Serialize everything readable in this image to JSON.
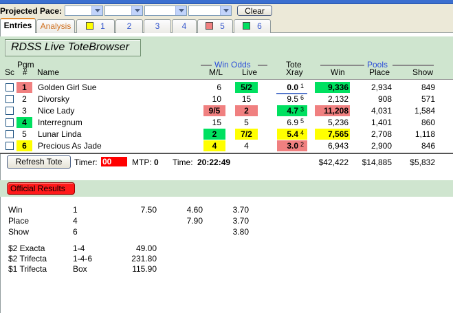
{
  "pace": {
    "label": "Projected Pace:",
    "clear_label": "Clear"
  },
  "tabs": {
    "entries": "Entries",
    "analysis": "Analysis",
    "t1": "1",
    "t2": "2",
    "t3": "3",
    "t4": "4",
    "t5": "5",
    "t6": "6",
    "colors": {
      "t1": "#ffff00",
      "t5": "#f08080",
      "t6": "#00e060"
    }
  },
  "title": "RDSS Live ToteBrowser",
  "headers": {
    "pgm": "Pgm",
    "sc": "Sc",
    "num": "#",
    "name": "Name",
    "win_odds": "Win Odds",
    "ml": "M/L",
    "live": "Live",
    "tote": "Tote",
    "xray": "Xray",
    "pools": "Pools",
    "win": "Win",
    "place": "Place",
    "show": "Show"
  },
  "colors": {
    "red": "#f08080",
    "green": "#00e060",
    "yellow": "#ffff00"
  },
  "entries": [
    {
      "pgm": "1",
      "name": "Golden Girl Sue",
      "ml": "6",
      "live": "5/2",
      "xray": "0.0",
      "xr": "1",
      "win": "9,336",
      "place": "2,934",
      "show": "849"
    },
    {
      "pgm": "2",
      "name": "Divorsky",
      "ml": "10",
      "live": "15",
      "xray": "9.5",
      "xr": "6",
      "win": "2,132",
      "place": "908",
      "show": "571"
    },
    {
      "pgm": "3",
      "name": "Nice Lady",
      "ml": "9/5",
      "live": "2",
      "xray": "4.7",
      "xr": "3",
      "win": "11,208",
      "place": "4,031",
      "show": "1,584"
    },
    {
      "pgm": "4",
      "name": "Interregnum",
      "ml": "15",
      "live": "5",
      "xray": "6.9",
      "xr": "5",
      "win": "5,236",
      "place": "1,401",
      "show": "860"
    },
    {
      "pgm": "5",
      "name": "Lunar Linda",
      "ml": "2",
      "live": "7/2",
      "xray": "5.4",
      "xr": "4",
      "win": "7,565",
      "place": "2,708",
      "show": "1,118"
    },
    {
      "pgm": "6",
      "name": "Precious As Jade",
      "ml": "4",
      "live": "4",
      "xray": "3.0",
      "xr": "2",
      "win": "6,943",
      "place": "2,900",
      "show": "846"
    }
  ],
  "footer": {
    "refresh_label": "Refresh Tote",
    "timer_label": "Timer:",
    "timer_value": "00",
    "mtp_label": "MTP:",
    "mtp_value": "0",
    "time_label": "Time:",
    "time_value": "20:22:49",
    "win_total": "$42,422",
    "place_total": "$14,885",
    "show_total": "$5,832"
  },
  "results": {
    "label": "Official Results",
    "rows": [
      {
        "type": "Win",
        "horse": "1",
        "win": "7.50",
        "place": "4.60",
        "show": "3.70"
      },
      {
        "type": "Place",
        "horse": "4",
        "win": "",
        "place": "7.90",
        "show": "3.70"
      },
      {
        "type": "Show",
        "horse": "6",
        "win": "",
        "place": "",
        "show": "3.80"
      }
    ],
    "exotics": [
      {
        "type": "$2 Exacta",
        "combo": "1-4",
        "payout": "49.00"
      },
      {
        "type": "$2 Trifecta",
        "combo": "1-4-6",
        "payout": "231.80"
      },
      {
        "type": "$1 Trifecta",
        "combo": "Box",
        "payout": "115.90"
      }
    ]
  }
}
